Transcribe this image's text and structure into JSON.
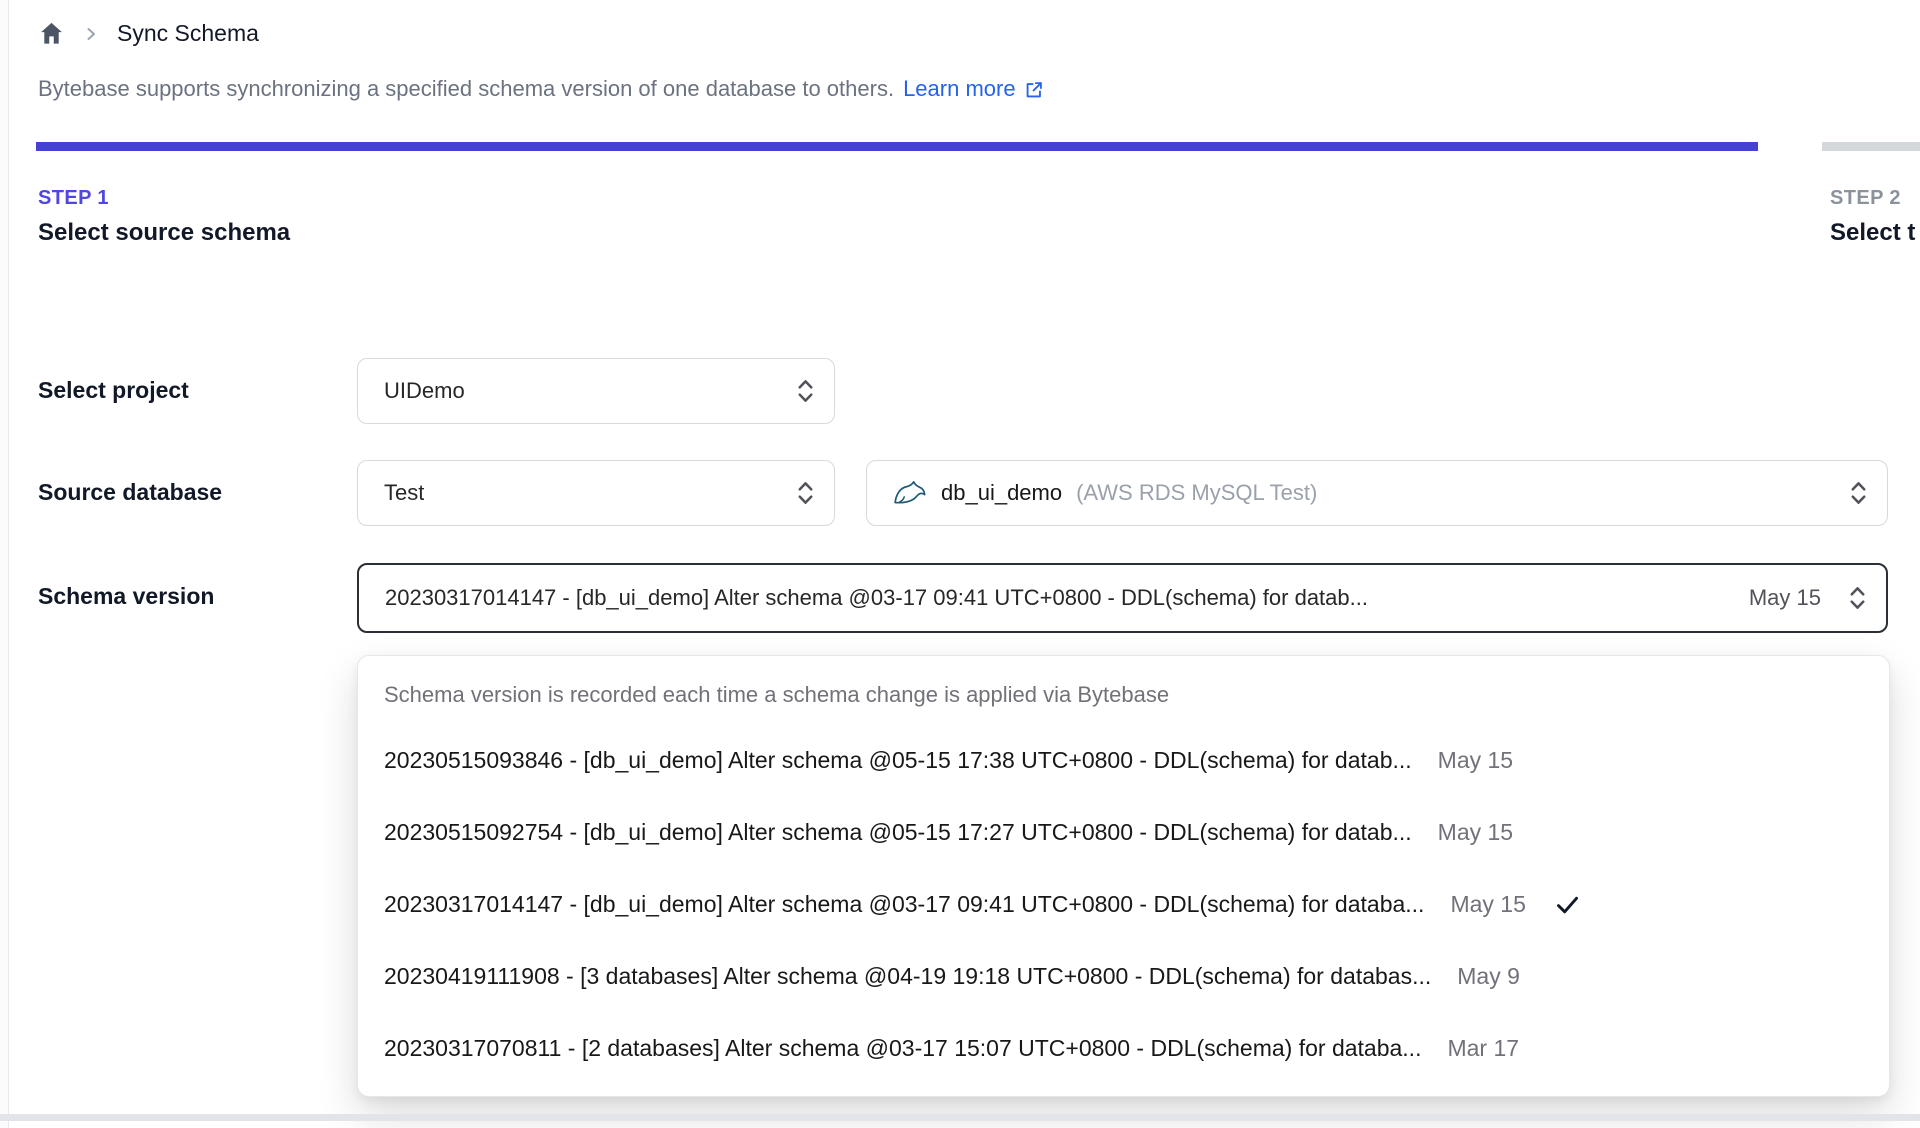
{
  "breadcrumb": {
    "title": "Sync Schema"
  },
  "description": {
    "text": "Bytebase supports synchronizing a specified schema version of one database to others.",
    "link_label": "Learn more"
  },
  "steps": [
    {
      "step": "STEP 1",
      "title": "Select source schema",
      "state": "active"
    },
    {
      "step": "STEP 2",
      "title": "Select t",
      "state": "upcoming"
    }
  ],
  "form": {
    "project": {
      "label": "Select project",
      "value": "UIDemo"
    },
    "source_database": {
      "label": "Source database",
      "environment_value": "Test",
      "database_value": "db_ui_demo",
      "database_detail": "(AWS RDS MySQL Test)"
    },
    "schema_version": {
      "label": "Schema version",
      "value": "20230317014147 - [db_ui_demo] Alter schema @03-17 09:41 UTC+0800 - DDL(schema) for datab...",
      "date": "May 15"
    }
  },
  "dropdown": {
    "help": "Schema version is recorded each time a schema change is applied via Bytebase",
    "options": [
      {
        "text": "20230515093846 - [db_ui_demo] Alter schema @05-15 17:38 UTC+0800 - DDL(schema) for datab...",
        "date": "May 15",
        "selected": false
      },
      {
        "text": "20230515092754 - [db_ui_demo] Alter schema @05-15 17:27 UTC+0800 - DDL(schema) for datab...",
        "date": "May 15",
        "selected": false
      },
      {
        "text": "20230317014147 - [db_ui_demo] Alter schema @03-17 09:41 UTC+0800 - DDL(schema) for databa...",
        "date": "May 15",
        "selected": true
      },
      {
        "text": "20230419111908 - [3 databases] Alter schema @04-19 19:18 UTC+0800 - DDL(schema) for databas...",
        "date": "May 9",
        "selected": false
      },
      {
        "text": "20230317070811 - [2 databases] Alter schema @03-17 15:07 UTC+0800 - DDL(schema) for databa...",
        "date": "Mar 17",
        "selected": false
      }
    ]
  },
  "colors": {
    "accent_bar": "#4540d6",
    "step_active": "#4f46e5",
    "link": "#2563eb",
    "mysql_teal": "#1e5a74"
  }
}
